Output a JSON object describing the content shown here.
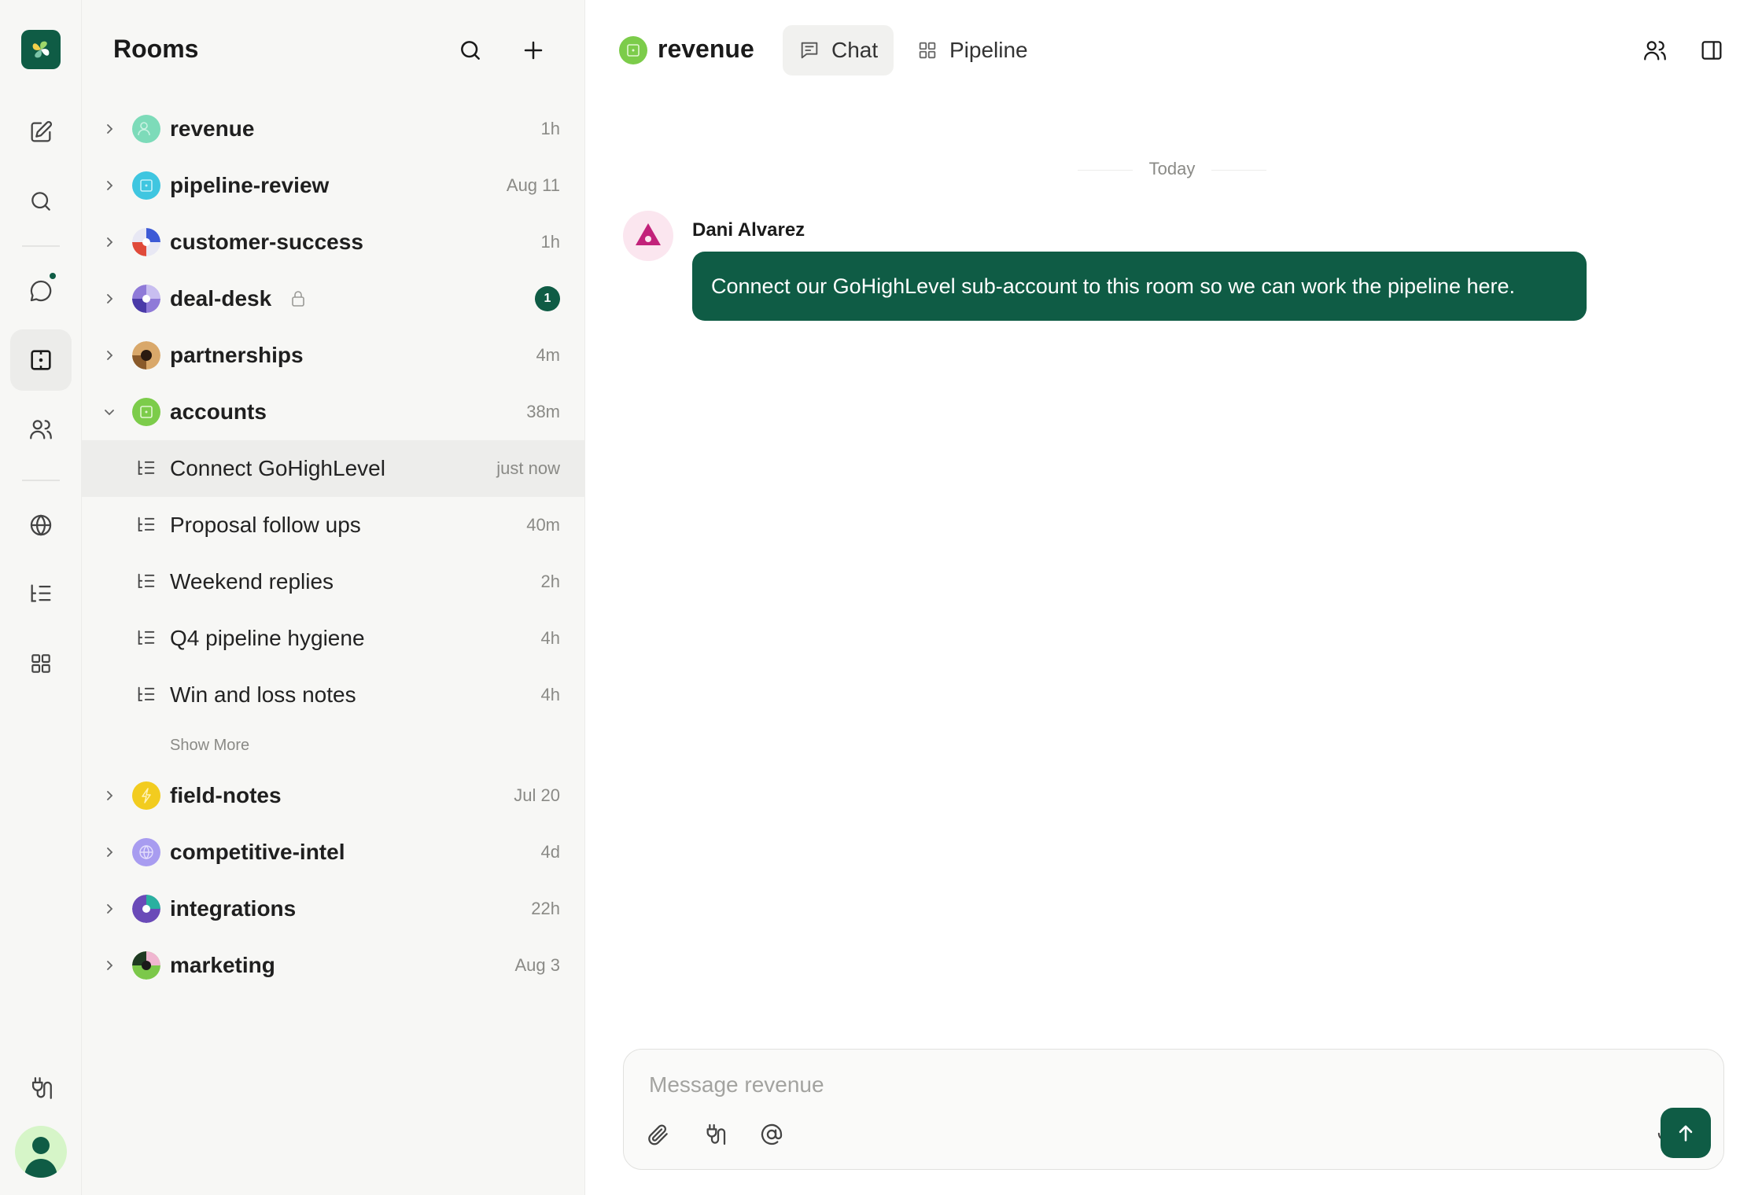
{
  "colors": {
    "accent": "#0f5c45",
    "panel_bg": "#f7f7f5",
    "muted_text": "#8a8a86"
  },
  "rail": {
    "items": [
      {
        "name": "compose",
        "icon": "compose-icon"
      },
      {
        "name": "search",
        "icon": "search-icon"
      },
      {
        "name": "chats",
        "icon": "chat-bubble-icon",
        "has_dot": true
      },
      {
        "name": "rooms",
        "icon": "room-icon",
        "active": true
      },
      {
        "name": "people",
        "icon": "people-icon"
      },
      {
        "name": "explore",
        "icon": "globe-icon"
      },
      {
        "name": "threads",
        "icon": "thread-list-icon"
      },
      {
        "name": "apps",
        "icon": "grid-icon"
      },
      {
        "name": "integrations",
        "icon": "plug-icon"
      }
    ]
  },
  "rooms_panel": {
    "title": "Rooms",
    "rooms_before": [
      {
        "name": "revenue",
        "time": "1h"
      },
      {
        "name": "pipeline-review",
        "time": "Aug 11"
      },
      {
        "name": "customer-success",
        "time": "1h"
      },
      {
        "name": "deal-desk",
        "time": "",
        "locked": true,
        "unread": "1"
      },
      {
        "name": "partnerships",
        "time": "4m"
      },
      {
        "name": "accounts",
        "time": "38m",
        "expanded": true
      }
    ],
    "threads": [
      {
        "name": "Connect GoHighLevel",
        "time": "just now",
        "active": true
      },
      {
        "name": "Proposal follow ups",
        "time": "40m"
      },
      {
        "name": "Weekend replies",
        "time": "2h"
      },
      {
        "name": "Q4 pipeline hygiene",
        "time": "4h"
      },
      {
        "name": "Win and loss notes",
        "time": "4h"
      }
    ],
    "show_more": "Show More",
    "rooms_after": [
      {
        "name": "field-notes",
        "time": "Jul 20"
      },
      {
        "name": "competitive-intel",
        "time": "4d"
      },
      {
        "name": "integrations",
        "time": "22h"
      },
      {
        "name": "marketing",
        "time": "Aug 3"
      }
    ]
  },
  "header": {
    "channel": "revenue",
    "tabs": [
      {
        "label": "Chat",
        "active": true
      },
      {
        "label": "Pipeline"
      }
    ]
  },
  "chat": {
    "date_divider": "Today",
    "messages": [
      {
        "author": "Dani Alvarez",
        "text": "Connect our GoHighLevel sub-account to this room so we can work the pipeline here."
      }
    ]
  },
  "composer": {
    "placeholder": "Message revenue"
  }
}
